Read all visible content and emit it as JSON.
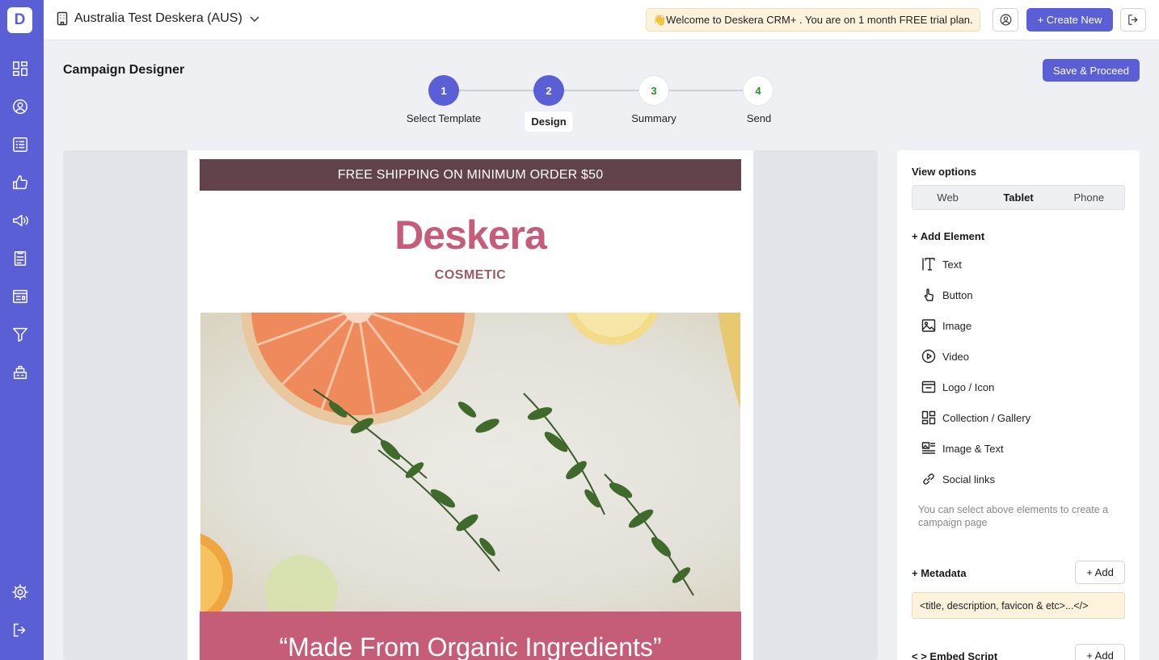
{
  "app": {
    "logo_letter": "D"
  },
  "topbar": {
    "org_name": "Australia Test Deskera (AUS)",
    "welcome": "👋Welcome to Deskera CRM+ . You are on 1 month FREE trial plan.",
    "create_label": "+ Create New"
  },
  "sidebar": {
    "items": [
      {
        "icon": "dashboard-icon"
      },
      {
        "icon": "contacts-icon"
      },
      {
        "icon": "list-icon"
      },
      {
        "icon": "deals-icon"
      },
      {
        "icon": "campaign-icon"
      },
      {
        "icon": "forms-icon"
      },
      {
        "icon": "landing-page-icon"
      },
      {
        "icon": "funnel-icon"
      },
      {
        "icon": "tickets-icon"
      }
    ],
    "bottom": [
      {
        "icon": "settings-icon"
      },
      {
        "icon": "logout-icon"
      }
    ]
  },
  "header": {
    "title": "Campaign Designer",
    "save_label": "Save & Proceed"
  },
  "stepper": {
    "steps": [
      {
        "number": "1",
        "label": "Select Template"
      },
      {
        "number": "2",
        "label": "Design"
      },
      {
        "number": "3",
        "label": "Summary"
      },
      {
        "number": "4",
        "label": "Send"
      }
    ],
    "active_step": 2
  },
  "email": {
    "banner": "FREE SHIPPING ON MINIMUM ORDER $50",
    "brand": "Deskera",
    "brand_sub": "COSMETIC",
    "quote": "“Made From Organic Ingredients”",
    "colors": {
      "banner": "#63434b",
      "brand": "#c55d78",
      "quote_bg": "#c55d78"
    }
  },
  "panel": {
    "view_options_title": "View options",
    "view_options": [
      "Web",
      "Tablet",
      "Phone"
    ],
    "selected_view": "Tablet",
    "add_element_title": "+ Add Element",
    "elements": [
      {
        "label": "Text",
        "icon": "text-icon"
      },
      {
        "label": "Button",
        "icon": "button-icon"
      },
      {
        "label": "Image",
        "icon": "image-icon"
      },
      {
        "label": "Video",
        "icon": "video-icon"
      },
      {
        "label": "Logo / Icon",
        "icon": "logo-icon"
      },
      {
        "label": "Collection / Gallery",
        "icon": "gallery-icon"
      },
      {
        "label": "Image & Text",
        "icon": "image-text-icon"
      },
      {
        "label": "Social links",
        "icon": "link-icon"
      }
    ],
    "hint": "You can select above elements to create a campaign page",
    "metadata_title": "+ Metadata",
    "metadata_add": "+ Add",
    "metadata_value": "<title, description, favicon & etc>...</>",
    "embed_title": "< > Embed Script",
    "embed_add": "+ Add"
  }
}
